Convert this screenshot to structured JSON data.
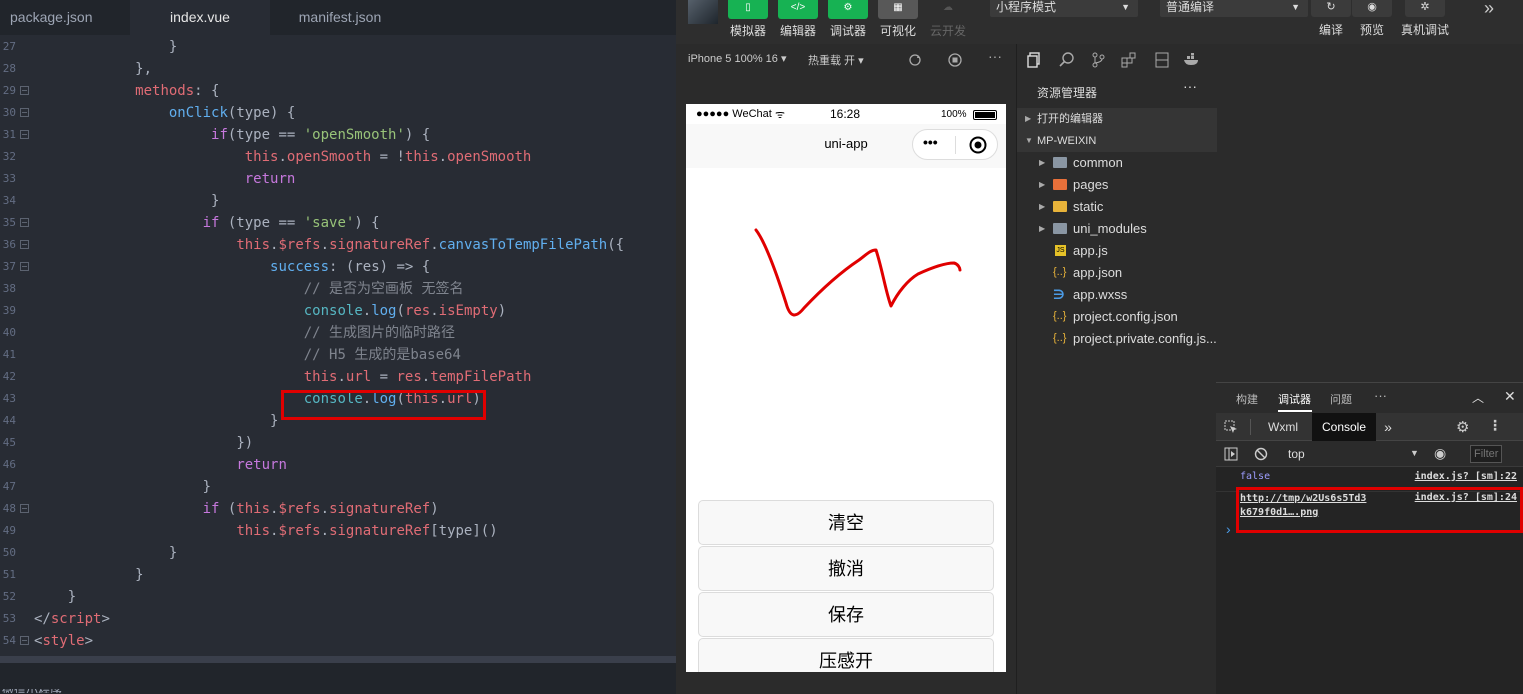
{
  "editor": {
    "tabs": [
      "package.json",
      "index.vue",
      "manifest.json"
    ],
    "active_tab": 1,
    "lines": [
      {
        "n": "27",
        "fold": false,
        "indent": 4,
        "parts": [
          [
            "op",
            "}"
          ]
        ]
      },
      {
        "n": "28",
        "fold": false,
        "indent": 3,
        "parts": [
          [
            "op",
            "},"
          ]
        ]
      },
      {
        "n": "29",
        "fold": true,
        "indent": 3,
        "parts": [
          [
            "red",
            "methods"
          ],
          [
            "op",
            ": {"
          ]
        ]
      },
      {
        "n": "30",
        "fold": true,
        "indent": 4,
        "parts": [
          [
            "fn",
            "onClick"
          ],
          [
            "op",
            "(type) {"
          ]
        ]
      },
      {
        "n": "31",
        "fold": true,
        "indent": 5.25,
        "parts": [
          [
            "kw",
            "if"
          ],
          [
            "op",
            "(type == "
          ],
          [
            "str",
            "'openSmooth'"
          ],
          [
            "op",
            ") {"
          ]
        ]
      },
      {
        "n": "32",
        "fold": false,
        "indent": 6.25,
        "parts": [
          [
            "red",
            "this"
          ],
          [
            "op",
            "."
          ],
          [
            "red",
            "openSmooth"
          ],
          [
            "op",
            " = !"
          ],
          [
            "red",
            "this"
          ],
          [
            "op",
            "."
          ],
          [
            "red",
            "openSmooth"
          ]
        ]
      },
      {
        "n": "33",
        "fold": false,
        "indent": 6.25,
        "parts": [
          [
            "kw",
            "return"
          ]
        ]
      },
      {
        "n": "34",
        "fold": false,
        "indent": 5.25,
        "parts": [
          [
            "op",
            "}"
          ]
        ]
      },
      {
        "n": "35",
        "fold": true,
        "indent": 5,
        "parts": [
          [
            "kw",
            "if"
          ],
          [
            "op",
            " (type == "
          ],
          [
            "str",
            "'save'"
          ],
          [
            "op",
            ") {"
          ]
        ]
      },
      {
        "n": "36",
        "fold": true,
        "indent": 6,
        "parts": [
          [
            "red",
            "this"
          ],
          [
            "op",
            "."
          ],
          [
            "red",
            "$refs"
          ],
          [
            "op",
            "."
          ],
          [
            "red",
            "signatureRef"
          ],
          [
            "op",
            "."
          ],
          [
            "fn",
            "canvasToTempFilePath"
          ],
          [
            "op",
            "({"
          ]
        ]
      },
      {
        "n": "37",
        "fold": true,
        "indent": 7,
        "parts": [
          [
            "fn",
            "success"
          ],
          [
            "op",
            ": (res) => {"
          ]
        ]
      },
      {
        "n": "38",
        "fold": false,
        "indent": 8,
        "parts": [
          [
            "cm",
            "// 是否为空画板 无签名"
          ]
        ]
      },
      {
        "n": "39",
        "fold": false,
        "indent": 8,
        "parts": [
          [
            "cyan",
            "console"
          ],
          [
            "op",
            "."
          ],
          [
            "fn",
            "log"
          ],
          [
            "op",
            "("
          ],
          [
            "red",
            "res"
          ],
          [
            "op",
            "."
          ],
          [
            "red",
            "isEmpty"
          ],
          [
            "op",
            ")"
          ]
        ]
      },
      {
        "n": "40",
        "fold": false,
        "indent": 8,
        "parts": [
          [
            "cm",
            "// 生成图片的临时路径"
          ]
        ]
      },
      {
        "n": "41",
        "fold": false,
        "indent": 8,
        "parts": [
          [
            "cm",
            "// H5 生成的是base64"
          ]
        ]
      },
      {
        "n": "42",
        "fold": false,
        "indent": 8,
        "parts": [
          [
            "red",
            "this"
          ],
          [
            "op",
            "."
          ],
          [
            "red",
            "url"
          ],
          [
            "op",
            " = "
          ],
          [
            "red",
            "res"
          ],
          [
            "op",
            "."
          ],
          [
            "red",
            "tempFilePath"
          ]
        ]
      },
      {
        "n": "43",
        "fold": false,
        "indent": 8,
        "parts": [
          [
            "cyan",
            "console"
          ],
          [
            "op",
            "."
          ],
          [
            "fn",
            "log"
          ],
          [
            "op",
            "("
          ],
          [
            "red",
            "this"
          ],
          [
            "op",
            "."
          ],
          [
            "red",
            "url"
          ],
          [
            "op",
            ")"
          ]
        ]
      },
      {
        "n": "44",
        "fold": false,
        "indent": 7,
        "parts": [
          [
            "op",
            "}"
          ]
        ]
      },
      {
        "n": "45",
        "fold": false,
        "indent": 6,
        "parts": [
          [
            "op",
            "})"
          ]
        ]
      },
      {
        "n": "46",
        "fold": false,
        "indent": 6,
        "parts": [
          [
            "kw",
            "return"
          ]
        ]
      },
      {
        "n": "47",
        "fold": false,
        "indent": 5,
        "parts": [
          [
            "op",
            "}"
          ]
        ]
      },
      {
        "n": "48",
        "fold": true,
        "indent": 5,
        "parts": [
          [
            "kw",
            "if"
          ],
          [
            "op",
            " ("
          ],
          [
            "red",
            "this"
          ],
          [
            "op",
            "."
          ],
          [
            "red",
            "$refs"
          ],
          [
            "op",
            "."
          ],
          [
            "red",
            "signatureRef"
          ],
          [
            "op",
            ")"
          ]
        ]
      },
      {
        "n": "49",
        "fold": false,
        "indent": 6,
        "parts": [
          [
            "red",
            "this"
          ],
          [
            "op",
            "."
          ],
          [
            "red",
            "$refs"
          ],
          [
            "op",
            "."
          ],
          [
            "red",
            "signatureRef"
          ],
          [
            "op",
            "[type]()"
          ]
        ]
      },
      {
        "n": "50",
        "fold": false,
        "indent": 4,
        "parts": [
          [
            "op",
            "}"
          ]
        ]
      },
      {
        "n": "51",
        "fold": false,
        "indent": 3,
        "parts": [
          [
            "op",
            "}"
          ]
        ]
      },
      {
        "n": "52",
        "fold": false,
        "indent": 1,
        "parts": [
          [
            "op",
            "}"
          ]
        ]
      },
      {
        "n": "53",
        "fold": false,
        "indent": 0,
        "parts": [
          [
            "op",
            "</"
          ],
          [
            "red",
            "script"
          ],
          [
            "op",
            ">"
          ]
        ]
      },
      {
        "n": "54",
        "fold": true,
        "indent": 0,
        "parts": [
          [
            "op",
            "<"
          ],
          [
            "red",
            "style"
          ],
          [
            "op",
            ">"
          ]
        ]
      }
    ],
    "footer_text": "微信小程序"
  },
  "toolbar": {
    "buttons": [
      {
        "label": "模拟器",
        "glyph": "▯",
        "active": true
      },
      {
        "label": "编辑器",
        "glyph": "</>",
        "active": true
      },
      {
        "label": "调试器",
        "glyph": "⚙",
        "active": true
      },
      {
        "label": "可视化",
        "glyph": "▦",
        "active": false
      },
      {
        "label": "云开发",
        "glyph": "☁",
        "active": false,
        "disabled": true
      }
    ],
    "mode_select": "小程序模式",
    "compile_select": "普通编译",
    "right_buttons": [
      {
        "label": "编译",
        "glyph": "↻"
      },
      {
        "label": "预览",
        "glyph": "◉"
      },
      {
        "label": "真机调试",
        "glyph": "✲"
      }
    ],
    "expand_glyph": "»"
  },
  "simulator": {
    "device": "iPhone 5 100% 16 ▾",
    "hotreload": "热重载 开 ▾",
    "status_carrier": "●●●●● WeChat",
    "status_time": "16:28",
    "status_battery": "100%",
    "nav_title": "uni-app",
    "buttons": [
      "清空",
      "撤消",
      "保存",
      "压感开"
    ]
  },
  "explorer": {
    "title": "资源管理器",
    "more": "···",
    "sections": [
      "打开的编辑器",
      "MP-WEIXIN"
    ],
    "files": [
      {
        "name": "common",
        "type": "folder-gray",
        "expandable": true
      },
      {
        "name": "pages",
        "type": "folder-orange",
        "expandable": true
      },
      {
        "name": "static",
        "type": "folder-yellow",
        "expandable": true
      },
      {
        "name": "uni_modules",
        "type": "folder-gray",
        "expandable": true
      },
      {
        "name": "app.js",
        "type": "js",
        "expandable": false
      },
      {
        "name": "app.json",
        "type": "json",
        "expandable": false
      },
      {
        "name": "app.wxss",
        "type": "css",
        "expandable": false
      },
      {
        "name": "project.config.json",
        "type": "json",
        "expandable": false
      },
      {
        "name": "project.private.config.js...",
        "type": "json",
        "expandable": false
      }
    ]
  },
  "debugger": {
    "tabs": [
      "构建",
      "调试器",
      "问题"
    ],
    "active_tab": 1,
    "more": "···",
    "panel_tabs": [
      "Wxml",
      "Console"
    ],
    "active_panel": 1,
    "more_panels": "»",
    "context": "top",
    "filter_placeholder": "Filter",
    "logs": [
      {
        "text": "false",
        "source": "index.js? [sm]:22",
        "color": "#9d9dff"
      },
      {
        "text": "http://tmp/w2Us6s5Td3k679f0d1….png",
        "source": "index.js? [sm]:24",
        "color": "#ddd"
      }
    ],
    "prompt": "›"
  }
}
